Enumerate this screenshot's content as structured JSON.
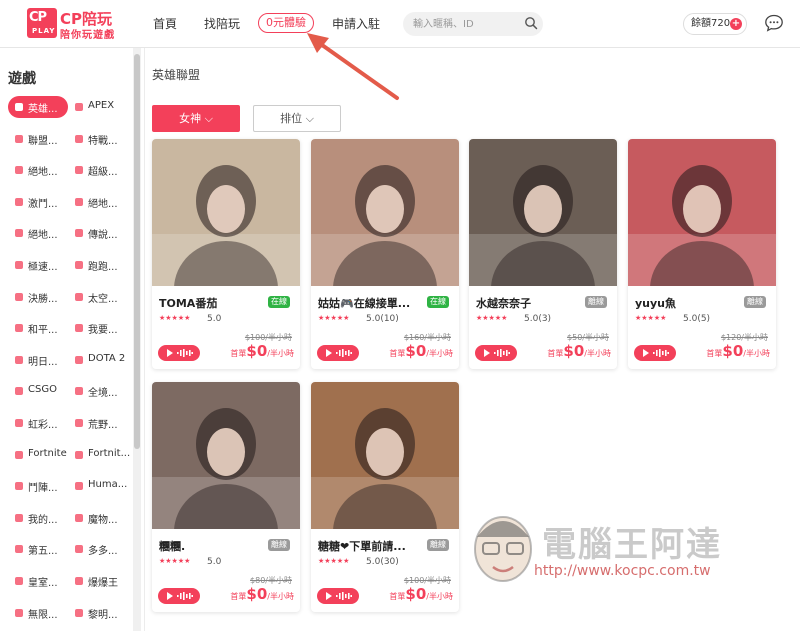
{
  "brand": {
    "logo_cp": "CP",
    "logo_play": "PLAY",
    "name": "CP陪玩",
    "slogan": "陪你玩遊戲"
  },
  "nav": {
    "home": "首頁",
    "find": "找陪玩",
    "free": "0元體驗",
    "apply": "申請入駐"
  },
  "search": {
    "placeholder": "輸入暱稱、ID"
  },
  "balance": {
    "label": "餘額720",
    "plus": "+"
  },
  "sidebar": {
    "title": "遊戲",
    "games": [
      "英雄...",
      "APEX",
      "聯盟...",
      "特戰...",
      "絕地...",
      "超級...",
      "激鬥...",
      "絕地...",
      "絕地...",
      "傳說...",
      "極速...",
      "跑跑...",
      "決勝...",
      "太空...",
      "和平...",
      "我要...",
      "明日...",
      "DOTA 2",
      "CSGO",
      "全境...",
      "虹彩...",
      "荒野...",
      "Fortnite",
      "Fortnit...",
      "鬥陣...",
      "Huma...",
      "我的...",
      "魔物...",
      "第五...",
      "多多...",
      "皇室...",
      "爆爆王",
      "無限...",
      "黎明..."
    ]
  },
  "main": {
    "title": "英雄聯盟",
    "filter_gender": "女神 ⌵",
    "filter_rank": "排位 ⌵"
  },
  "cards": [
    {
      "name": "TOMA番茄",
      "status": "在線",
      "online": true,
      "stars": "★★★★★",
      "rating": "5.0",
      "orig": "$100/半小時",
      "first_label": "首單",
      "price": "$0",
      "unit": "/半小時",
      "photo_color": "#c9b7a0"
    },
    {
      "name": "姑姑🎮在線接單...",
      "status": "在線",
      "online": true,
      "stars": "★★★★★",
      "rating": "5.0(10)",
      "orig": "$160/半小時",
      "first_label": "首單",
      "price": "$0",
      "unit": "/半小時",
      "photo_color": "#b88f7c"
    },
    {
      "name": "水越奈奈子",
      "status": "離線",
      "online": false,
      "stars": "★★★★★",
      "rating": "5.0(3)",
      "orig": "$50/半小時",
      "first_label": "首單",
      "price": "$0",
      "unit": "/半小時",
      "photo_color": "#6b5e55"
    },
    {
      "name": "yuyu魚",
      "status": "離線",
      "online": false,
      "stars": "★★★★★",
      "rating": "5.0(5)",
      "orig": "$120/半小時",
      "first_label": "首單",
      "price": "$0",
      "unit": "/半小時",
      "photo_color": "#c65a5f"
    },
    {
      "name": "糰糰.",
      "status": "離線",
      "online": false,
      "stars": "★★★★★",
      "rating": "5.0",
      "orig": "$80/半小時",
      "first_label": "首單",
      "price": "$0",
      "unit": "/半小時",
      "photo_color": "#7d6a62"
    },
    {
      "name": "糖糖❤下單前請...",
      "status": "離線",
      "online": false,
      "stars": "★★★★★",
      "rating": "5.0(30)",
      "orig": "$100/半小時",
      "first_label": "首單",
      "price": "$0",
      "unit": "/半小時",
      "photo_color": "#a0704e"
    }
  ],
  "watermark": {
    "title": "電腦王阿達",
    "url": "http://www.kocpc.com.tw"
  },
  "colors": {
    "accent": "#f3405a",
    "online": "#2fb344",
    "offline": "#9a9a9a"
  }
}
